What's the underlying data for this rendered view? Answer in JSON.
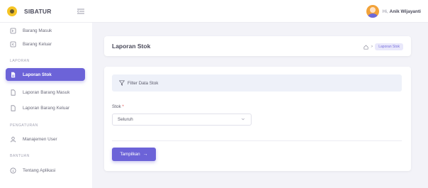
{
  "app": {
    "name": "SIBATUR"
  },
  "user": {
    "greeting": "Hi,",
    "name": "Anik Wijayanti"
  },
  "sidebar": {
    "items_top": [
      {
        "label": "Barang Masuk",
        "icon": "login-icon"
      },
      {
        "label": "Barang Keluar",
        "icon": "logout-icon"
      }
    ],
    "section_laporan": "LAPORAN",
    "laporan_items": [
      {
        "label": "Laporan Stok",
        "icon": "file-icon",
        "active": true
      },
      {
        "label": "Laporan Barang Masuk",
        "icon": "file-icon"
      },
      {
        "label": "Laporan Barang Keluar",
        "icon": "file-icon"
      }
    ],
    "section_pengaturan": "PENGATURAN",
    "pengaturan_items": [
      {
        "label": "Manajemen User",
        "icon": "user-icon"
      }
    ],
    "section_bantuan": "BANTUAN",
    "bantuan_items": [
      {
        "label": "Tentang Aplikasi",
        "icon": "info-icon"
      }
    ]
  },
  "header": {
    "title": "Laporan Stok",
    "breadcrumb_current": "Laporan Stok",
    "breadcrumb_sep": ">"
  },
  "filter": {
    "title": "Filter Data Stok",
    "stok_label": "Stok",
    "stok_required": "*",
    "stok_value": "Seluruh",
    "submit_label": "Tampilkan",
    "submit_arrow": "→"
  },
  "colors": {
    "accent": "#6c63d8",
    "background": "#f3f3f8",
    "brand_yellow": "#f5c425"
  }
}
